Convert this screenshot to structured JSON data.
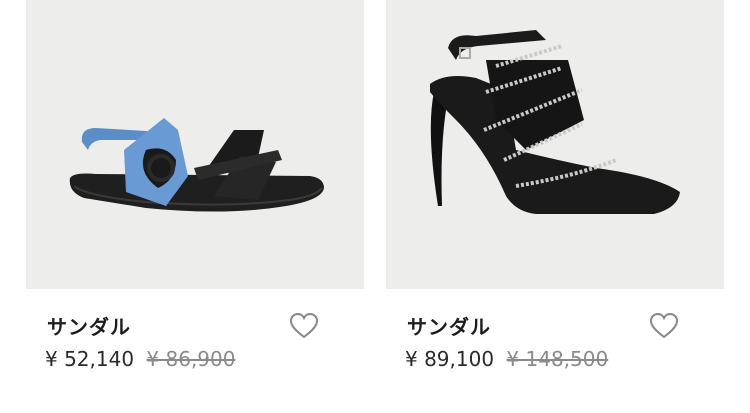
{
  "products": [
    {
      "name": "サンダル",
      "price": "¥ 52,140",
      "original_price": "¥ 86,900",
      "image": "blue-black-strap-sandal",
      "favorite_icon": "heart-outline-icon"
    },
    {
      "name": "サンダル",
      "price": "¥ 89,100",
      "original_price": "¥ 148,500",
      "image": "black-rhinestone-strap-heel",
      "favorite_icon": "heart-outline-icon"
    }
  ],
  "colors": {
    "image_background": "#ededeb",
    "text": "#222222",
    "strikethrough": "#8a8a8a"
  }
}
